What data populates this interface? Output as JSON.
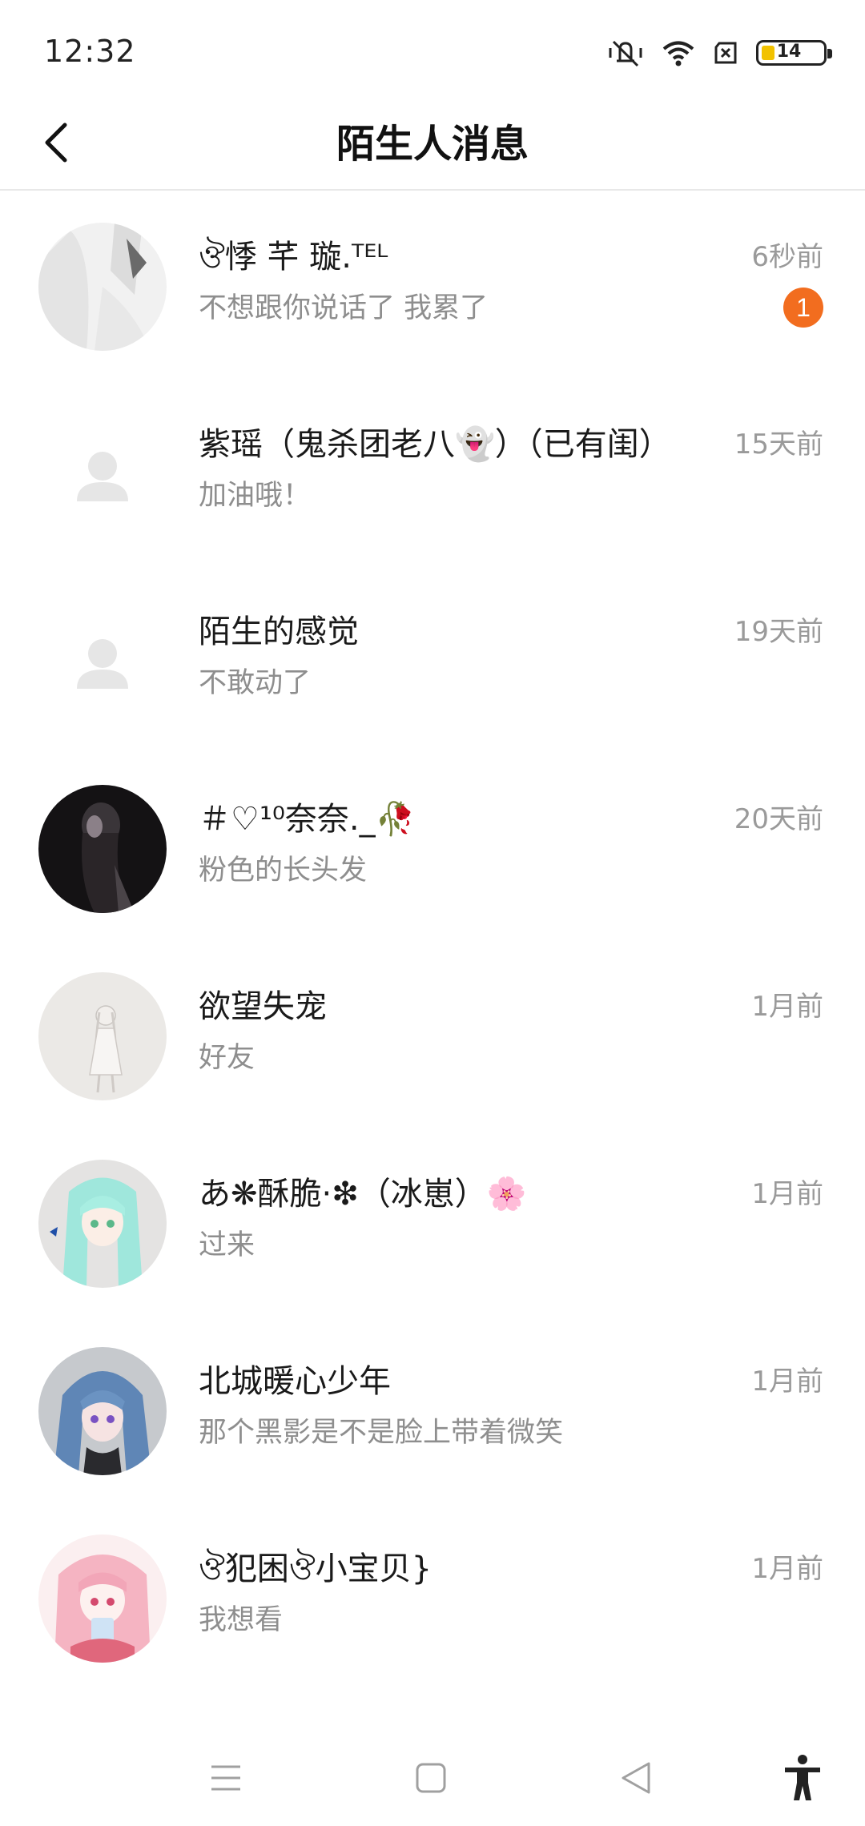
{
  "status_bar": {
    "time": "12:32",
    "battery_level": "14",
    "icons": [
      "vibrate-icon",
      "wifi-icon",
      "sim-card-icon",
      "battery-icon"
    ]
  },
  "header": {
    "title": "陌生人消息",
    "back_icon": "chevron-left-icon"
  },
  "colors": {
    "badge": "#f26d1f",
    "name_text": "#1a1a1a",
    "secondary_text": "#8e8e8e",
    "divider": "#e8e8e8"
  },
  "conversations": [
    {
      "name": "ঔ悸 芊 璇.ᵀᴱᴸ",
      "message": "不想跟你说话了 我累了",
      "time": "6秒前",
      "unread": "1"
    },
    {
      "name": "紫瑶（鬼杀团老八👻）（已有闺）",
      "message": "加油哦！",
      "time": "15天前"
    },
    {
      "name": "陌生的感觉",
      "message": "不敢动了",
      "time": "19天前"
    },
    {
      "name": "＃♡¹⁰奈奈._🥀",
      "message": "粉色的长头发",
      "time": "20天前"
    },
    {
      "name": "欲望失宠",
      "message": "好友",
      "time": "1月前"
    },
    {
      "name": "あ❋酥脆·❇（冰崽）🌸",
      "message": "过来",
      "time": "1月前"
    },
    {
      "name": "北城暖心少年",
      "message": "那个黑影是不是脸上带着微笑",
      "time": "1月前"
    },
    {
      "name": "ঔ犯困ঔ小宝贝}",
      "message": "我想看",
      "time": "1月前"
    }
  ],
  "nav_bar": [
    "menu-icon",
    "home-square-icon",
    "back-triangle-icon",
    "accessibility-icon"
  ]
}
